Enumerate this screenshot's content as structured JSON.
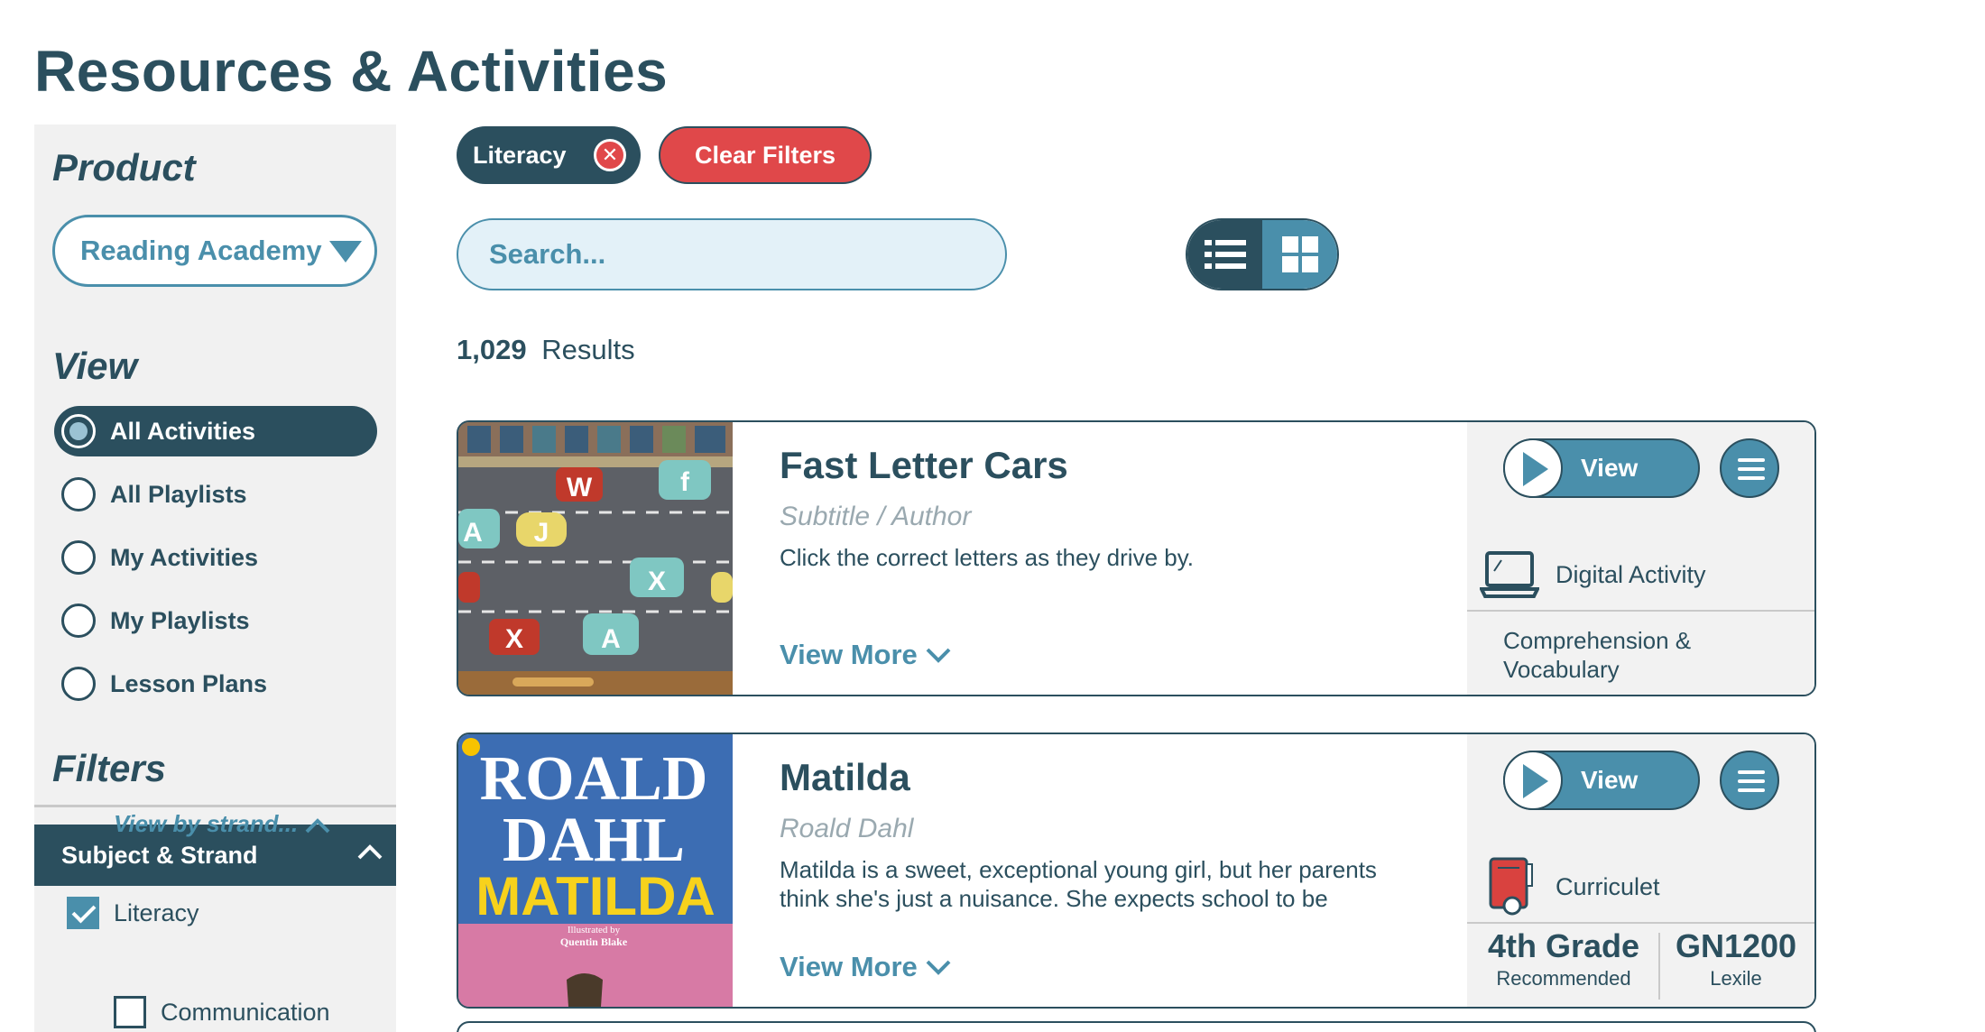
{
  "page": {
    "title": "Resources & Activities"
  },
  "sidebar": {
    "product_heading": "Product",
    "product_value": "Reading Academy",
    "view_heading": "View",
    "view_options": [
      {
        "label": "All Activities",
        "selected": true
      },
      {
        "label": "All Playlists",
        "selected": false
      },
      {
        "label": "My Activities",
        "selected": false
      },
      {
        "label": "My Playlists",
        "selected": false
      },
      {
        "label": "Lesson Plans",
        "selected": false
      }
    ],
    "filters_heading": "Filters",
    "subject_strand": "Subject & Strand",
    "literacy_label": "Literacy",
    "view_by_strand": "View by strand...",
    "communication_label": "Communication"
  },
  "filters": {
    "active_chip": "Literacy",
    "clear_label": "Clear Filters",
    "search_placeholder": "Search..."
  },
  "results": {
    "count": "1,029",
    "label": "Results"
  },
  "cards": [
    {
      "title": "Fast Letter Cars",
      "subtitle": "Subtitle / Author",
      "description": "Click the correct letters as they drive by.",
      "view_more": "View More",
      "view_label": "View",
      "type": "Digital Activity",
      "strand": "Comprehension & Vocabulary"
    },
    {
      "title": "Matilda",
      "subtitle": "Roald Dahl",
      "description": "Matilda is a sweet, exceptional young girl, but her parents think she's just a nuisance. She expects school to be",
      "view_more": "View More",
      "view_label": "View",
      "type": "Curriculet",
      "grade": "4th Grade",
      "grade_label": "Recommended",
      "lexile": "GN1200",
      "lexile_label": "Lexile",
      "cover_author_line1": "ROALD",
      "cover_author_line2": "DAHL",
      "cover_title": "MATILDA",
      "cover_illustrated": "Illustrated by",
      "cover_illustrator": "Quentin Blake"
    }
  ],
  "game_letters": [
    "W",
    "f",
    "A",
    "J",
    "X",
    "X",
    "A"
  ],
  "colors": {
    "primary": "#2b4f5e",
    "accent": "#4a8fab",
    "danger": "#e0484a",
    "panel": "#f1f1f1"
  }
}
